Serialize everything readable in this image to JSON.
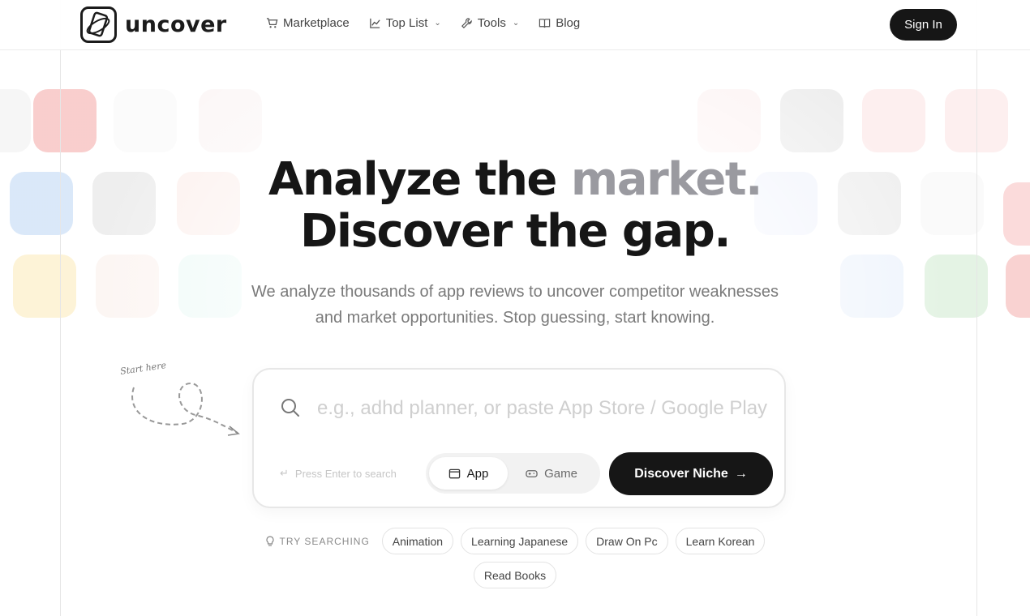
{
  "header": {
    "brand": "uncover",
    "nav": [
      {
        "label": "Marketplace",
        "icon": "cart-icon"
      },
      {
        "label": "Top List",
        "icon": "chart-line-icon",
        "dropdown": true
      },
      {
        "label": "Tools",
        "icon": "wrench-icon",
        "dropdown": true
      },
      {
        "label": "Blog",
        "icon": "book-icon"
      }
    ],
    "signin_label": "Sign In"
  },
  "hero": {
    "line1_a": "Analyze the ",
    "line1_b": "market.",
    "line2": "Discover the gap.",
    "sub_line1": "We analyze thousands of app reviews to uncover competitor weaknesses",
    "sub_line2": "and market opportunities. Stop guessing, start knowing."
  },
  "doodle": {
    "label": "Start here"
  },
  "search": {
    "placeholder": "e.g., adhd planner, or paste App Store / Google Play",
    "enter_hint": "Press Enter to search",
    "toggle": {
      "app": "App",
      "game": "Game",
      "selected": "App"
    },
    "discover_label": "Discover Niche"
  },
  "try_searching": {
    "label": "TRY SEARCHING",
    "chips": [
      "Animation",
      "Learning Japanese",
      "Draw On Pc",
      "Learn Korean",
      "Read Books"
    ]
  },
  "colors": {
    "accent_dark": "#161616",
    "muted_headline": "#9a9aa0"
  }
}
